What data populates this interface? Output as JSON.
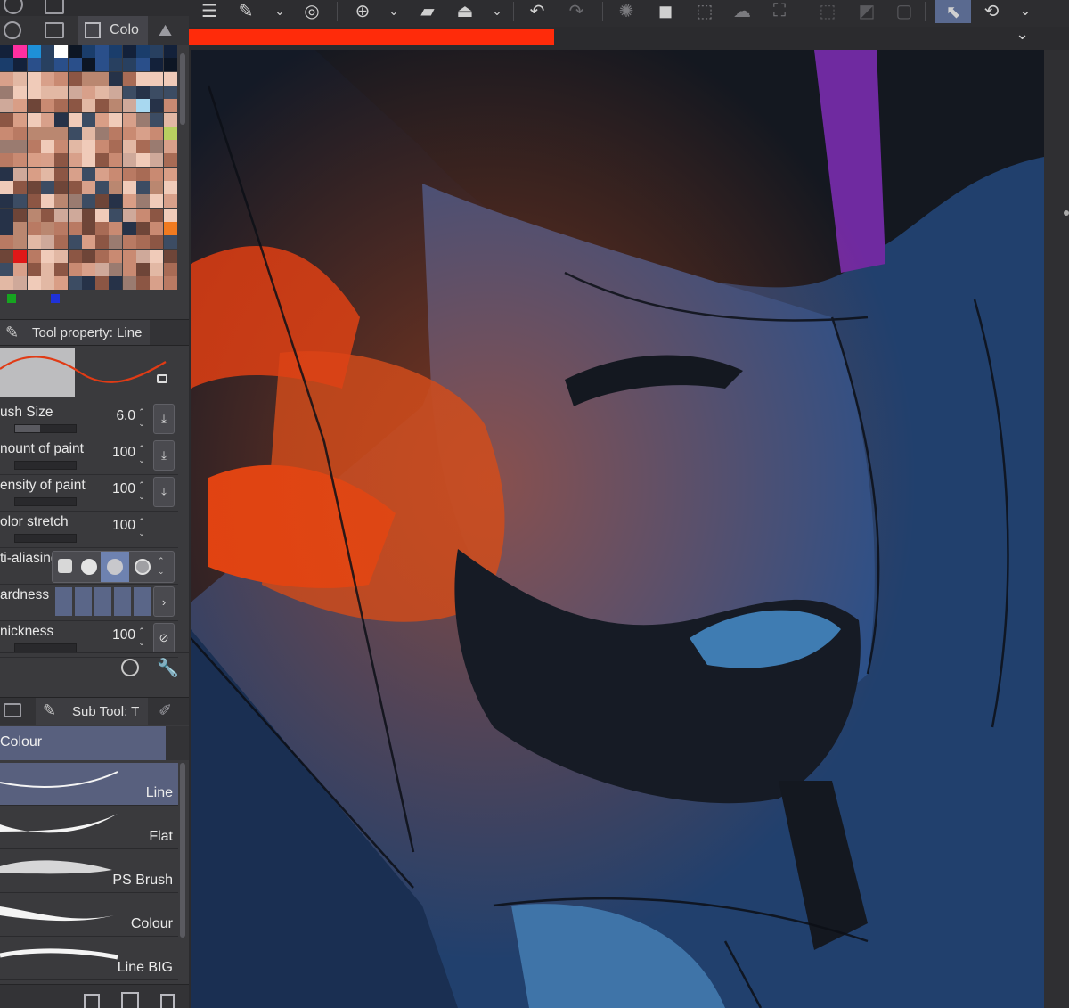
{
  "palette_tab": {
    "label": "Colo"
  },
  "tool_property": {
    "title": "Tool property: Line",
    "rows": [
      {
        "label": "ush Size",
        "value": "6.0"
      },
      {
        "label": "nount of paint",
        "value": "100"
      },
      {
        "label": "ensity of paint",
        "value": "100"
      },
      {
        "label": "olor stretch",
        "value": "100"
      },
      {
        "label": "ti-aliasing",
        "value": ""
      },
      {
        "label": "ardness",
        "value": ""
      },
      {
        "label": "nickness",
        "value": "100"
      }
    ]
  },
  "sub_tool": {
    "title": "Sub Tool: T",
    "group": "Colour",
    "brushes": [
      "Line",
      "Flat",
      "PS Brush",
      "Colour",
      "Line BIG"
    ],
    "selected": "Line"
  },
  "colors": {
    "progress": "#ff2b0a",
    "canvas_bg": "#1f3a63",
    "selected_brush": "#58607e"
  }
}
